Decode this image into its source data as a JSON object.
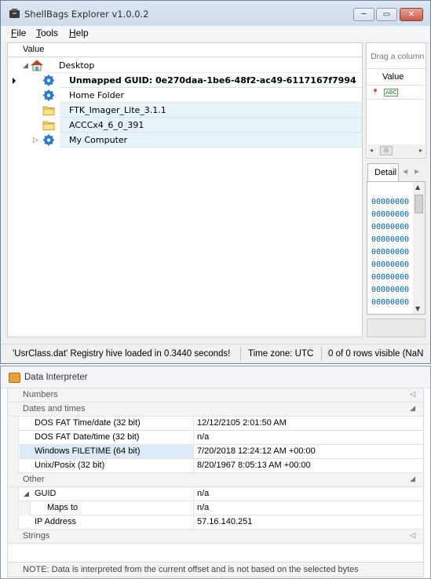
{
  "window": {
    "title": "ShellBags Explorer v1.0.0.2",
    "controls": {
      "minimize": "─",
      "maximize": "▭",
      "close": "✕"
    }
  },
  "menu": [
    {
      "label_first": "F",
      "label_rest": "ile"
    },
    {
      "label_first": "T",
      "label_rest": "ools"
    },
    {
      "label_first": "H",
      "label_rest": "elp"
    }
  ],
  "tree": {
    "column_header": "Value",
    "rows": [
      {
        "label": "Desktop",
        "icon": "home-icon",
        "bold": false,
        "selected": false
      },
      {
        "label": "Unmapped GUID: 0e270daa-1be6-48f2-ac49-6117167f7994",
        "icon": "gear-icon",
        "bold": true,
        "selected": true
      },
      {
        "label": "Home Folder",
        "icon": "gear-icon",
        "bold": false,
        "selected": false
      },
      {
        "label": "FTK_Imager_Lite_3.1.1",
        "icon": "folder-icon",
        "bold": false,
        "selected": false
      },
      {
        "label": "ACCCx4_6_0_391",
        "icon": "folder-icon",
        "bold": false,
        "selected": false
      },
      {
        "label": "My Computer",
        "icon": "gear-icon",
        "bold": false,
        "selected": false
      }
    ]
  },
  "right_pane": {
    "drag_hint": "Drag a column",
    "column_header": "Value",
    "detail_tab": "Detail",
    "hex_lines": [
      "00000000",
      "00000000",
      "00000000",
      "00000000",
      "00000000",
      "00000000",
      "00000000",
      "00000000",
      "00000000",
      "00000000"
    ]
  },
  "status": {
    "message": "'UsrClass.dat' Registry hive loaded in 0.3440 seconds!",
    "timezone": "Time zone: UTC",
    "rows_visible": "0 of 0 rows visible (NaN"
  },
  "interpreter": {
    "title": "Data Interpreter",
    "categories": {
      "numbers": "Numbers",
      "dates": "Dates and times",
      "other": "Other",
      "strings": "Strings"
    },
    "dates_rows": [
      {
        "name": "DOS FAT Time/date (32 bit)",
        "value": "12/12/2105 2:01:50 AM"
      },
      {
        "name": "DOS FAT Date/time (32 bit)",
        "value": "n/a"
      },
      {
        "name": "Windows FILETIME (64 bit)",
        "value": "7/20/2018 12:24:12 AM +00:00"
      },
      {
        "name": "Unix/Posix (32 bit)",
        "value": "8/20/1967 8:05:13 AM +00:00"
      }
    ],
    "other_rows": [
      {
        "name": "GUID",
        "value": "n/a"
      },
      {
        "name": "Maps to",
        "value": "n/a"
      },
      {
        "name": "IP Address",
        "value": "57.16.140.251"
      }
    ],
    "note": "NOTE: Data is interpreted from the current offset and is not based on the selected bytes"
  }
}
